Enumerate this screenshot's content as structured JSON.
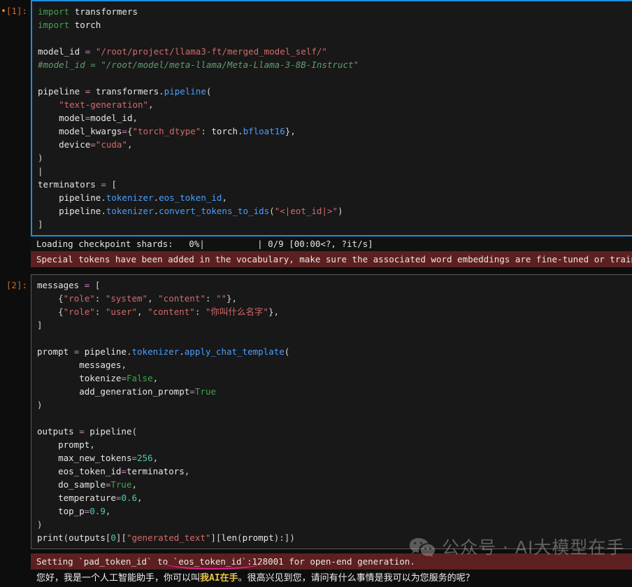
{
  "notebook": {
    "cells": [
      {
        "prompt_modified_marker": "•",
        "prompt": "[1]:",
        "selected": true,
        "code_lines": [
          "import transformers",
          "import torch",
          "",
          "model_id = \"/root/project/llama3-ft/merged_model_self/\"",
          "#model_id = \"/root/model/meta-llama/Meta-Llama-3-8B-Instruct\"",
          "",
          "pipeline = transformers.pipeline(",
          "    \"text-generation\",",
          "    model=model_id,",
          "    model_kwargs={\"torch_dtype\": torch.bfloat16},",
          "    device=\"cuda\",",
          ")",
          "",
          "terminators = [",
          "    pipeline.tokenizer.eos_token_id,",
          "    pipeline.tokenizer.convert_tokens_to_ids(\"<|eot_id|>\")",
          "]"
        ],
        "outputs": [
          {
            "kind": "stream",
            "text": "Loading checkpoint shards:   0%|          | 0/9 [00:00<?, ?it/s]"
          },
          {
            "kind": "warning",
            "text": "Special tokens have been added in the vocabulary, make sure the associated word embeddings are fine-tuned or trained."
          }
        ]
      },
      {
        "prompt_modified_marker": "",
        "prompt": "[2]:",
        "selected": false,
        "code_lines": [
          "messages = [",
          "    {\"role\": \"system\", \"content\": \"\"},",
          "    {\"role\": \"user\", \"content\": \"你叫什么名字\"},",
          "]",
          "",
          "prompt = pipeline.tokenizer.apply_chat_template(",
          "        messages,",
          "        tokenize=False,",
          "        add_generation_prompt=True",
          ")",
          "",
          "outputs = pipeline(",
          "    prompt,",
          "    max_new_tokens=256,",
          "    eos_token_id=terminators,",
          "    do_sample=True,",
          "    temperature=0.6,",
          "    top_p=0.9,",
          ")",
          "print(outputs[0][\"generated_text\"][len(prompt):])"
        ],
        "outputs": [
          {
            "kind": "warning",
            "text": "Setting `pad_token_id` to `eos_token_id`:128001 for open-end generation."
          },
          {
            "kind": "final",
            "text_before_highlight": "您好，我是一个人工智能助手，你可以叫",
            "highlight": "我AI在手",
            "text_after_highlight": "。很高兴见到您，请问有什么事情是我可以为您服务的呢？"
          }
        ]
      }
    ]
  },
  "watermark": {
    "icon": "wechat-logo-icon",
    "text": "公众号 · AI大模型在手"
  },
  "colors": {
    "selected_cell_border": "#1f8fe0",
    "unselected_cell_border": "#5a5a5a",
    "warning_background": "#5c2020",
    "highlight_text": "#e8c547",
    "annotation_underline": "#e01f8f",
    "prompt_label": "#d06a1f",
    "code_background": "#181818",
    "page_background": "#0d0d0d"
  }
}
